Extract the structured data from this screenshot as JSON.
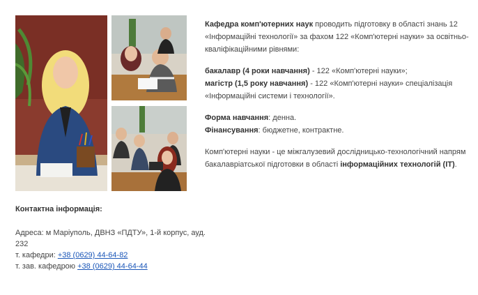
{
  "intro": {
    "dept_name": "Кафедра комп'ютерних наук",
    "text": " проводить підготовку в області знань 12 «Інформаційні технології» за фахом 122 «Комп'ютерні науки» за освітньо-кваліфікаційними рівнями:"
  },
  "levels": {
    "bachelor_label": "бакалавр (4 роки навчання)",
    "bachelor_text": " - 122 «Комп'ютерні науки»;",
    "master_label": "магістр (1,5 року навчання)",
    "master_text": " - 122 «Комп'ютерні науки» спеціалізація «Інформаційні системи і технології»."
  },
  "study": {
    "form_label": "Форма навчання",
    "form_value": ": денна.",
    "finance_label": "Фінансування",
    "finance_value": ": бюджетне, контрактне."
  },
  "description": {
    "text": "Комп'ютерні науки - це міжгалузевий дослідницько-технологічний напрям бакалавріатської підготовки в області ",
    "highlight": "інформаційних технологій (ІТ)",
    "end": "."
  },
  "contact": {
    "title": "Контактна інформація:",
    "address": "Адреса: м Маріуполь, ДВНЗ «ПДТУ», 1-й корпус, ауд. 232",
    "dept_phone_label": "т. кафедри: ",
    "dept_phone": "+38 (0629) 44-64-82",
    "head_phone_label": "т. зав. кафедрою ",
    "head_phone": "+38 (0629) 44-64-44"
  },
  "colors": {
    "link": "#1a56b8",
    "text": "#444444",
    "bold_text": "#333333"
  }
}
